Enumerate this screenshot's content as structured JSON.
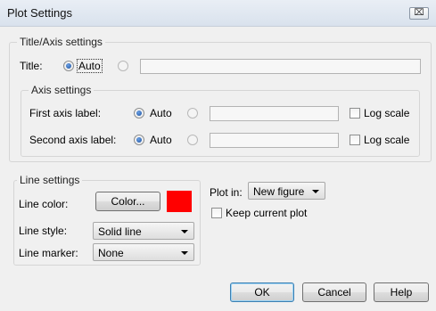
{
  "window": {
    "title": "Plot Settings",
    "close_glyph": "⌧"
  },
  "title_axis": {
    "legend": "Title/Axis settings",
    "title_label": "Title:",
    "auto_label": "Auto",
    "title_mode": "auto",
    "title_value": ""
  },
  "axis": {
    "legend": "Axis settings",
    "first_label": "First axis label:",
    "second_label": "Second axis label:",
    "auto_label": "Auto",
    "first_value": "",
    "second_value": "",
    "log_scale_label": "Log scale",
    "first_log_scale": false,
    "second_log_scale": false
  },
  "line": {
    "legend": "Line settings",
    "color_label": "Line color:",
    "color_button": "Color...",
    "color_value": "#ff0000",
    "style_label": "Line style:",
    "style_value": "Solid line",
    "marker_label": "Line marker:",
    "marker_value": "None"
  },
  "plot": {
    "plot_in_label": "Plot in:",
    "plot_in_value": "New figure",
    "keep_label": "Keep current plot",
    "keep_checked": false
  },
  "buttons": {
    "ok": "OK",
    "cancel": "Cancel",
    "help": "Help"
  }
}
